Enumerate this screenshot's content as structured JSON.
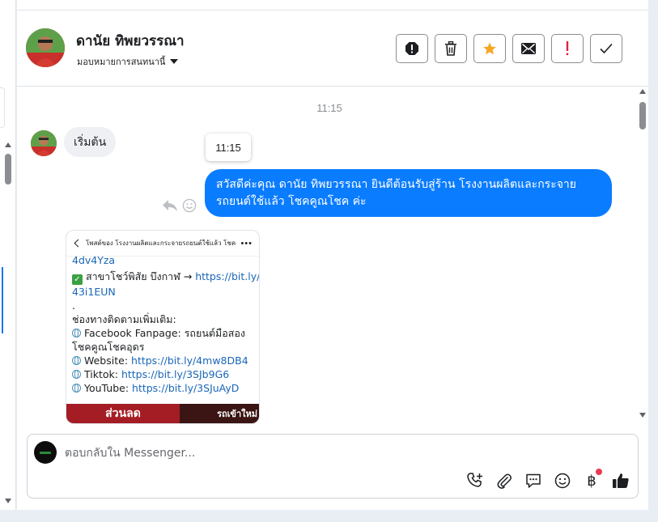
{
  "header": {
    "contact_name": "ดานัย ทิพยวรรณา",
    "assign_label": "มอบหมายการสนทนานี้",
    "actions": [
      "spam-icon",
      "trash-icon",
      "star-icon",
      "mail-icon",
      "important-icon",
      "check-icon"
    ]
  },
  "chat": {
    "time_center": "11:15",
    "tooltip_time": "11:15",
    "incoming_message": "เริ่มต้น",
    "outgoing_message": "สวัสดีค่ะคุณ ดานัย ทิพยวรรณา ยินดีต้อนรับสู่ร้าน โรงงานผลิตและกระจายรถยนต์ใช้แล้ว โชคคูณโชค ค่ะ",
    "shared_post": {
      "title": "โพสต์ของ โรงงานผลิตและกระจายรถยนต์ใช้แล้ว โชค...",
      "partial_top": "4dv4Yza",
      "branch_line": "สาขาโชว์พิสัย บึงกาฬ →",
      "branch_link_1": "https://bit.ly/",
      "branch_link_2": "43i1EUN",
      "dot": ".",
      "channels_heading": "ช่องทางติดตามเพิ่มเติม:",
      "fanpage_label": "Facebook Fanpage: รถยนต์มือสอง",
      "fanpage_label_2": "โชคคูณโชคอุดร",
      "website_label": "Website:",
      "website_link": "https://bit.ly/4mw8DB4",
      "tiktok_label": "Tiktok:",
      "tiktok_link": "https://bit.ly/3SJb9G6",
      "youtube_label": "YouTube:",
      "youtube_link": "https://bit.ly/3SJuAyD",
      "banner_left": "ส่วนลด",
      "banner_right": "รถเข้าใหม่"
    }
  },
  "composer": {
    "placeholder": "ตอบกลับใน Messenger...",
    "tools": [
      "call-add-icon",
      "attachment-icon",
      "saved-reply-icon",
      "emoji-icon",
      "baht-icon",
      "like-icon"
    ],
    "baht_symbol": "฿"
  },
  "colors": {
    "accent": "#0a7cff",
    "star": "#f5a623",
    "important": "#e41e3f"
  }
}
